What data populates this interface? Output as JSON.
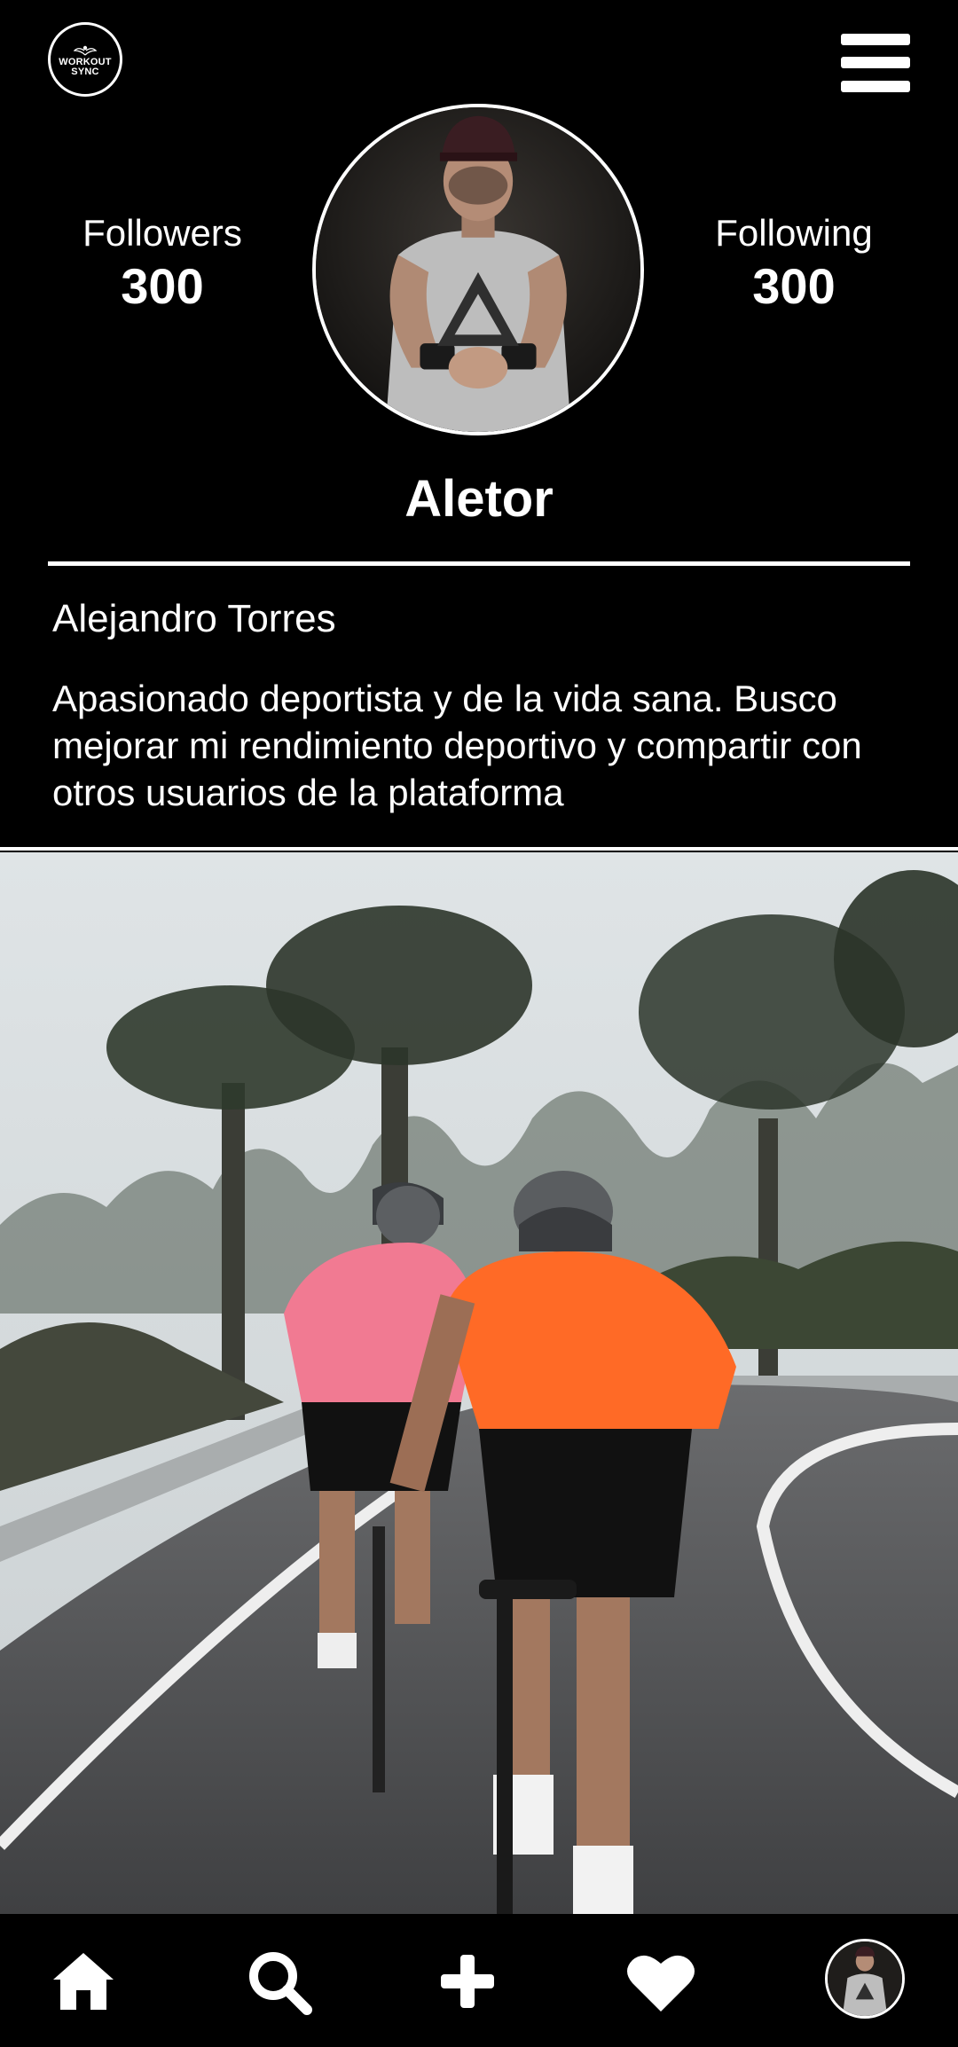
{
  "app": {
    "logo_line1": "WORKOUT",
    "logo_line2": "SYNC"
  },
  "header": {
    "menu_icon": "hamburger-menu-icon"
  },
  "profile": {
    "followers_label": "Followers",
    "followers_count": "300",
    "following_label": "Following",
    "following_count": "300",
    "username": "Aletor",
    "full_name": "Alejandro Torres",
    "bio": "Apasionado deportista y de la vida sana. Busco mejorar mi rendimiento deportivo y compartir con otros usuarios de la plataforma"
  },
  "bottom_nav": {
    "items": [
      {
        "icon": "home-icon"
      },
      {
        "icon": "search-icon"
      },
      {
        "icon": "plus-icon"
      },
      {
        "icon": "heart-icon"
      },
      {
        "icon": "profile-avatar"
      }
    ]
  },
  "colors": {
    "background": "#000000",
    "foreground": "#ffffff"
  }
}
